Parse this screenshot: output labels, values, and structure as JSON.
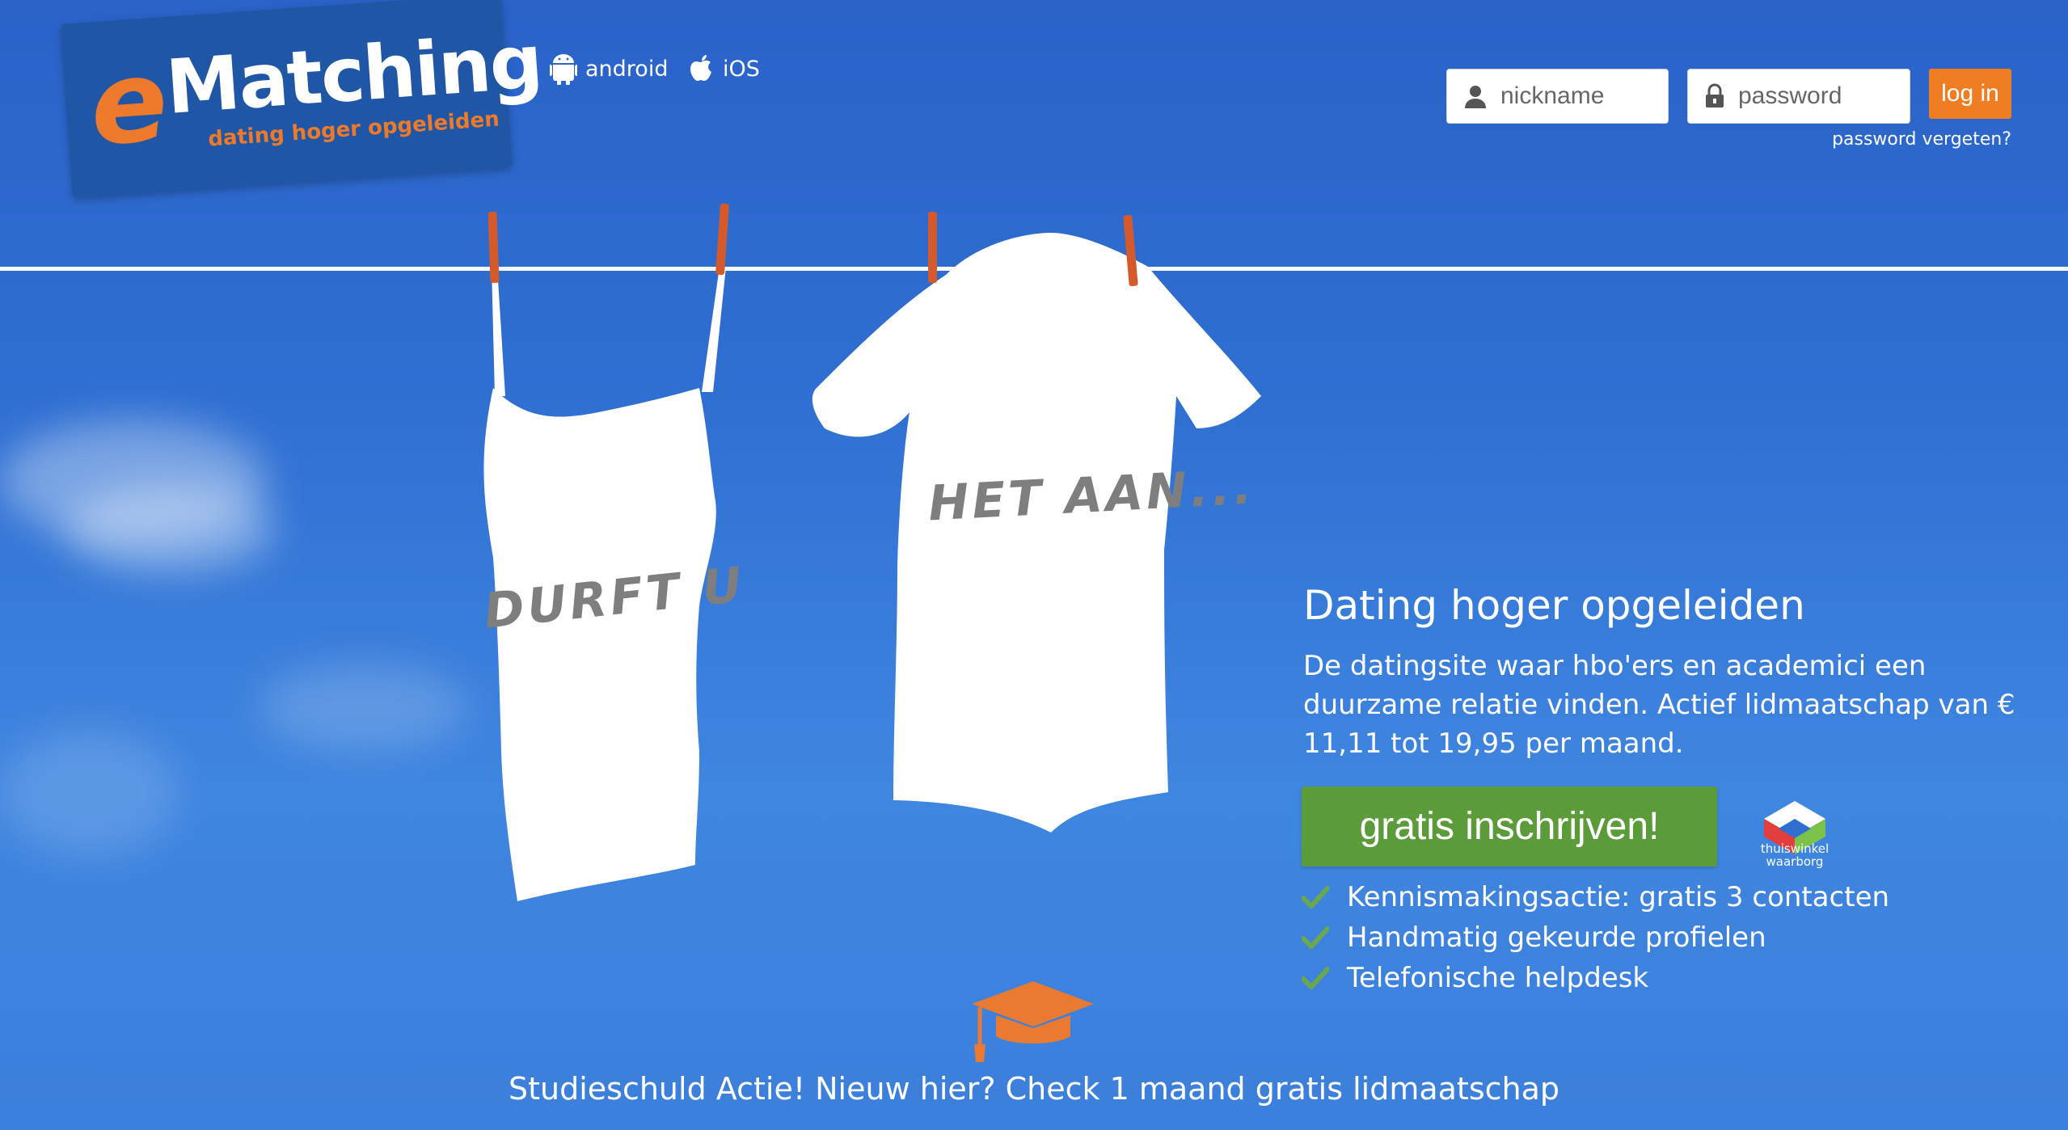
{
  "header": {
    "logo": {
      "letter": "e",
      "word": "Matching",
      "tagline": "dating hoger opgeleiden"
    },
    "apps": [
      {
        "icon": "android-icon",
        "label": "android"
      },
      {
        "icon": "apple-icon",
        "label": "iOS"
      }
    ],
    "login": {
      "nickname_placeholder": "nickname",
      "password_placeholder": "password",
      "login_label": "log in",
      "forgot_label": "password vergeten?"
    }
  },
  "hero": {
    "shirt_left_text": "DURFT U",
    "shirt_right_text": "HET AAN...",
    "headline": "Dating hoger opgeleiden",
    "subtext": "De datingsite waar hbo'ers en academici een duurzame relatie vinden. Actief lidmaatschap van € 11,11 tot 19,95 per maand.",
    "cta_label": "gratis inschrijven!",
    "badge": {
      "icon": "thuiswinkel-waarborg-icon",
      "line1": "thuiswinkel",
      "line2": "waarborg"
    },
    "features": [
      "Kennismakingsactie: gratis 3 contacten",
      "Handmatig gekeurde profielen",
      "Telefonische helpdesk"
    ]
  },
  "promo": {
    "icon": "graduation-cap-icon",
    "text": "Studieschuld Actie! Nieuw hier? Check 1 maand gratis lidmaatschap"
  },
  "colors": {
    "brand_blue": "#1f57a6",
    "brand_orange": "#ec7a2a",
    "cta_green": "#5c9b3a",
    "check_green": "#6aa84f"
  }
}
